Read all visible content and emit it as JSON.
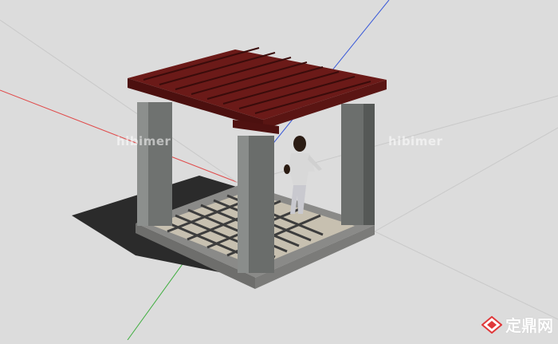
{
  "viewport": {
    "background": "#dcdcdc",
    "axis_colors": {
      "red": "#e04a4a",
      "green": "#3fae3f",
      "blue": "#3a5ad8"
    }
  },
  "model": {
    "subject": "pergola with stone columns and walking figure",
    "beam_color": "#6b1a18",
    "column_color": "#6f7270",
    "base_color": "#8a8a88"
  },
  "watermarks": {
    "left": "hibimer",
    "right": "hibimer"
  },
  "logo": {
    "text": "定鼎网",
    "icon": "diamond-logo-icon",
    "accent": "#e0383a"
  }
}
